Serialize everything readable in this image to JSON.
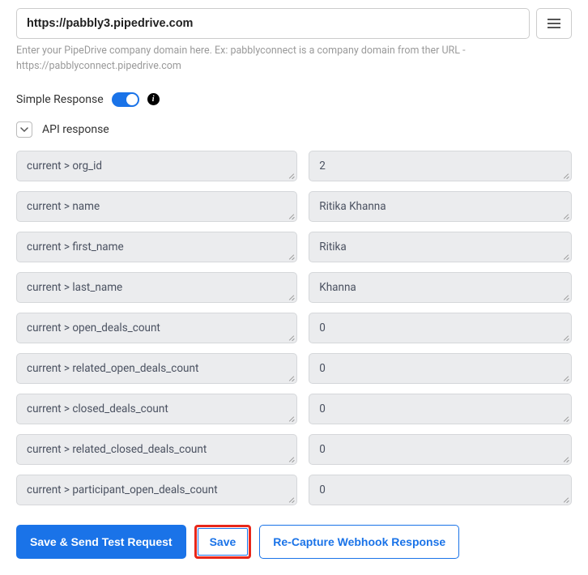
{
  "domain_input": {
    "value": "https://pabbly3.pipedrive.com",
    "help": "Enter your PipeDrive company domain here. Ex: pabblyconnect is a company domain from ther URL - https://pabblyconnect.pipedrive.com"
  },
  "simple_response": {
    "label": "Simple Response"
  },
  "api_response": {
    "label": "API response",
    "fields": [
      {
        "key": "current > org_id",
        "value": "2"
      },
      {
        "key": "current > name",
        "value": "Ritika Khanna"
      },
      {
        "key": "current > first_name",
        "value": "Ritika"
      },
      {
        "key": "current > last_name",
        "value": "Khanna"
      },
      {
        "key": "current > open_deals_count",
        "value": "0"
      },
      {
        "key": "current > related_open_deals_count",
        "value": "0"
      },
      {
        "key": "current > closed_deals_count",
        "value": "0"
      },
      {
        "key": "current > related_closed_deals_count",
        "value": "0"
      },
      {
        "key": "current > participant_open_deals_count",
        "value": "0"
      }
    ]
  },
  "buttons": {
    "save_send": "Save & Send Test Request",
    "save": "Save",
    "recapture": "Re-Capture Webhook Response"
  }
}
